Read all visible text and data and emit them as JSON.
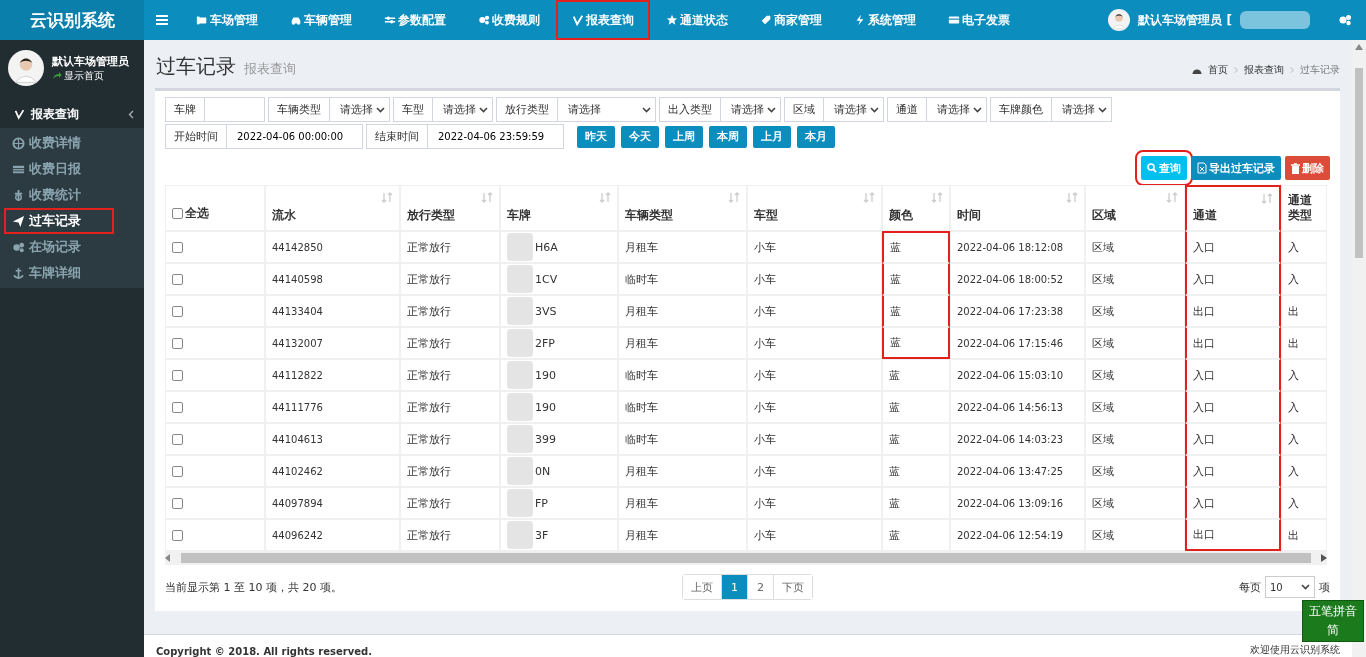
{
  "app_title": "云识别系统",
  "nav": [
    {
      "label": "车场管理",
      "highlighted": false
    },
    {
      "label": "车辆管理",
      "highlighted": false
    },
    {
      "label": "参数配置",
      "highlighted": false
    },
    {
      "label": "收费规则",
      "highlighted": false
    },
    {
      "label": "报表查询",
      "highlighted": true
    },
    {
      "label": "通道状态",
      "highlighted": false
    },
    {
      "label": "商家管理",
      "highlighted": false
    },
    {
      "label": "系统管理",
      "highlighted": false
    },
    {
      "label": "电子发票",
      "highlighted": false
    }
  ],
  "user_menu": {
    "name": "默认车场管理员 ["
  },
  "sidebar": {
    "user_name": "默认车场管理员",
    "user_link": "显示首页",
    "section": {
      "label": "报表查询",
      "expanded": true
    },
    "items": [
      {
        "label": "收费详情",
        "selected": false,
        "highlighted": false
      },
      {
        "label": "收费日报",
        "selected": false,
        "highlighted": false
      },
      {
        "label": "收费统计",
        "selected": false,
        "highlighted": false
      },
      {
        "label": "过车记录",
        "selected": true,
        "highlighted": true
      },
      {
        "label": "在场记录",
        "selected": false,
        "highlighted": false
      },
      {
        "label": "车牌详细",
        "selected": false,
        "highlighted": false
      }
    ]
  },
  "page": {
    "title": "过车记录",
    "subtitle": "报表查询",
    "breadcrumb": [
      "首页",
      "报表查询",
      "过车记录"
    ]
  },
  "filters": [
    {
      "label": "车牌",
      "kind": "text"
    },
    {
      "label": "车辆类型",
      "kind": "select",
      "value": "请选择"
    },
    {
      "label": "车型",
      "kind": "select",
      "value": "请选择"
    },
    {
      "label": "放行类型",
      "kind": "select",
      "value": "请选择",
      "wide": true
    },
    {
      "label": "出入类型",
      "kind": "select",
      "value": "请选择"
    },
    {
      "label": "区域",
      "kind": "select",
      "value": "请选择"
    },
    {
      "label": "通道",
      "kind": "select",
      "value": "请选择"
    },
    {
      "label": "车牌颜色",
      "kind": "select",
      "value": "请选择"
    },
    {
      "label": "开始时间",
      "kind": "text",
      "value": "2022-04-06 00:00:00"
    },
    {
      "label": "结束时间",
      "kind": "text",
      "value": "2022-04-06 23:59:59"
    }
  ],
  "quick_ranges": [
    "昨天",
    "今天",
    "上周",
    "本周",
    "上月",
    "本月"
  ],
  "actions": [
    {
      "label": "查询",
      "kind": "query",
      "highlighted": true
    },
    {
      "label": "导出过车记录",
      "kind": "export",
      "highlighted": false
    },
    {
      "label": "删除",
      "kind": "delete",
      "highlighted": false
    }
  ],
  "table": {
    "select_all": {
      "label": "全选",
      "checked": false
    },
    "columns": [
      {
        "label": "流水",
        "sortable": true,
        "highlighted": false
      },
      {
        "label": "放行类型",
        "sortable": true,
        "highlighted": false
      },
      {
        "label": "车牌",
        "sortable": true,
        "highlighted": false
      },
      {
        "label": "车辆类型",
        "sortable": true,
        "highlighted": false
      },
      {
        "label": "车型",
        "sortable": true,
        "highlighted": false
      },
      {
        "label": "颜色",
        "sortable": true,
        "highlighted": false
      },
      {
        "label": "时间",
        "sortable": true,
        "highlighted": false
      },
      {
        "label": "区域",
        "sortable": true,
        "highlighted": false
      },
      {
        "label": "通道",
        "sortable": true,
        "highlighted": true
      },
      {
        "label": "通道类型",
        "sortable": false,
        "highlighted": false
      }
    ],
    "rows": [
      {
        "checked": false,
        "color_highlighted": true,
        "cells": [
          "44142850",
          "正常放行",
          "H6A",
          "月租车",
          "小车",
          "蓝",
          "2022-04-06 18:12:08",
          "区域",
          "入口",
          "入"
        ]
      },
      {
        "checked": false,
        "color_highlighted": true,
        "cells": [
          "44140598",
          "正常放行",
          "1CV",
          "临时车",
          "小车",
          "蓝",
          "2022-04-06 18:00:52",
          "区域",
          "入口",
          "入"
        ]
      },
      {
        "checked": false,
        "color_highlighted": true,
        "cells": [
          "44133404",
          "正常放行",
          "3VS",
          "月租车",
          "小车",
          "蓝",
          "2022-04-06 17:23:38",
          "区域",
          "出口",
          "出"
        ]
      },
      {
        "checked": false,
        "color_highlighted": true,
        "cells": [
          "44132007",
          "正常放行",
          "2FP",
          "月租车",
          "小车",
          "蓝",
          "2022-04-06 17:15:46",
          "区域",
          "出口",
          "出"
        ]
      },
      {
        "checked": false,
        "color_highlighted": false,
        "cells": [
          "44112822",
          "正常放行",
          "190",
          "临时车",
          "小车",
          "蓝",
          "2022-04-06 15:03:10",
          "区域",
          "入口",
          "入"
        ]
      },
      {
        "checked": false,
        "color_highlighted": false,
        "cells": [
          "44111776",
          "正常放行",
          "190",
          "临时车",
          "小车",
          "蓝",
          "2022-04-06 14:56:13",
          "区域",
          "入口",
          "入"
        ]
      },
      {
        "checked": false,
        "color_highlighted": false,
        "cells": [
          "44104613",
          "正常放行",
          "399",
          "临时车",
          "小车",
          "蓝",
          "2022-04-06 14:03:23",
          "区域",
          "入口",
          "入"
        ]
      },
      {
        "checked": false,
        "color_highlighted": false,
        "cells": [
          "44102462",
          "正常放行",
          "0N",
          "月租车",
          "小车",
          "蓝",
          "2022-04-06 13:47:25",
          "区域",
          "入口",
          "入"
        ]
      },
      {
        "checked": false,
        "color_highlighted": false,
        "cells": [
          "44097894",
          "正常放行",
          "FP",
          "月租车",
          "小车",
          "蓝",
          "2022-04-06 13:09:16",
          "区域",
          "入口",
          "入"
        ]
      },
      {
        "checked": false,
        "color_highlighted": false,
        "cells": [
          "44096242",
          "正常放行",
          "3F",
          "月租车",
          "小车",
          "蓝",
          "2022-04-06 12:54:19",
          "区域",
          "出口",
          "出"
        ]
      }
    ]
  },
  "pagination": {
    "summary": "当前显示第 1 至 10 项，共 20 项。",
    "prev": "上页",
    "pages": [
      {
        "label": "1",
        "selected": true
      },
      {
        "label": "2",
        "selected": false
      }
    ],
    "next": "下页",
    "per_page_label": "每页",
    "per_page": "10",
    "per_page_suffix": "项"
  },
  "footer": {
    "copyright": "Copyright © 2018. All rights reserved.",
    "welcome": "欢迎使用云识别系统"
  },
  "ime": {
    "mode": "五笔拼音",
    "charset": "简"
  }
}
